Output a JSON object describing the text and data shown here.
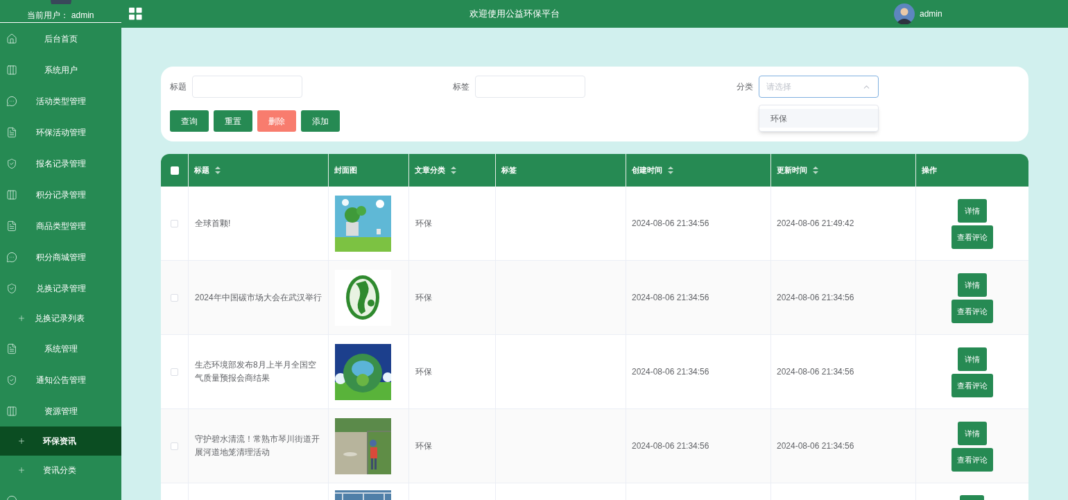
{
  "sidebar": {
    "current_user": "当前用户： admin",
    "items": [
      {
        "label": "后台首页",
        "kind": "home",
        "selected": false
      },
      {
        "label": "系统用户",
        "kind": "columns",
        "selected": false
      },
      {
        "label": "活动类型管理",
        "kind": "chat",
        "selected": false
      },
      {
        "label": "环保活动管理",
        "kind": "doc",
        "selected": false
      },
      {
        "label": "报名记录管理",
        "kind": "shield",
        "selected": false
      },
      {
        "label": "积分记录管理",
        "kind": "columns",
        "selected": false
      },
      {
        "label": "商品类型管理",
        "kind": "doc",
        "selected": false
      },
      {
        "label": "积分商城管理",
        "kind": "chat",
        "selected": false
      },
      {
        "label": "兑换记录管理",
        "kind": "shield",
        "selected": false
      },
      {
        "label": "兑换记录列表",
        "kind": "sub",
        "selected": false
      },
      {
        "label": "系统管理",
        "kind": "doc",
        "selected": false
      },
      {
        "label": "通知公告管理",
        "kind": "shield",
        "selected": false
      },
      {
        "label": "资源管理",
        "kind": "columns",
        "selected": false
      },
      {
        "label": "环保资讯",
        "kind": "sub",
        "selected": true
      },
      {
        "label": "资讯分类",
        "kind": "sub",
        "selected": false
      }
    ]
  },
  "header": {
    "title": "欢迎使用公益环保平台",
    "user": "admin"
  },
  "search": {
    "fields": [
      {
        "label": "标题",
        "kind": "input"
      },
      {
        "label": "标签",
        "kind": "input"
      },
      {
        "label": "分类",
        "kind": "select",
        "placeholder": "请选择",
        "expanded": true,
        "options": [
          "环保"
        ]
      }
    ],
    "buttons": [
      {
        "label": "查询",
        "kind": "primary"
      },
      {
        "label": "重置",
        "kind": "primary"
      },
      {
        "label": "删除",
        "kind": "danger"
      },
      {
        "label": "添加",
        "kind": "primary"
      }
    ]
  },
  "table": {
    "select_all_checked": false,
    "columns": [
      {
        "label": "标题",
        "sortable": true
      },
      {
        "label": "封面图",
        "sortable": false
      },
      {
        "label": "文章分类",
        "sortable": true
      },
      {
        "label": "标签",
        "sortable": false
      },
      {
        "label": "创建时间",
        "sortable": true
      },
      {
        "label": "更新时间",
        "sortable": true
      },
      {
        "label": "操作",
        "sortable": false
      }
    ],
    "rows": [
      {
        "checked": false,
        "title": "全球首颗!",
        "cover": {
          "kind": "picture"
        },
        "category": "环保",
        "created": "2024-08-06 21:34:56",
        "updated": "2024-08-06 21:49:42",
        "actions": [
          "详情",
          "查看评论"
        ]
      },
      {
        "checked": false,
        "title": "2024年中国碳市场大会在武汉举行",
        "cover": {
          "kind": "picture"
        },
        "category": "环保",
        "created": "2024-08-06 21:34:56",
        "updated": "2024-08-06 21:34:56",
        "actions": [
          "详情",
          "查看评论"
        ]
      },
      {
        "checked": false,
        "title": "生态环境部发布8月上半月全国空气质量预报会商结果",
        "cover": {
          "kind": "picture"
        },
        "category": "环保",
        "created": "2024-08-06 21:34:56",
        "updated": "2024-08-06 21:34:56",
        "actions": [
          "详情",
          "查看评论"
        ]
      },
      {
        "checked": false,
        "title": "守护碧水清流！常熟市琴川街道开展河道地笼清理活动",
        "cover": {
          "kind": "picture"
        },
        "category": "环保",
        "created": "2024-08-06 21:34:56",
        "updated": "2024-08-06 21:34:56",
        "actions": [
          "详情",
          "查看评论"
        ]
      }
    ]
  }
}
